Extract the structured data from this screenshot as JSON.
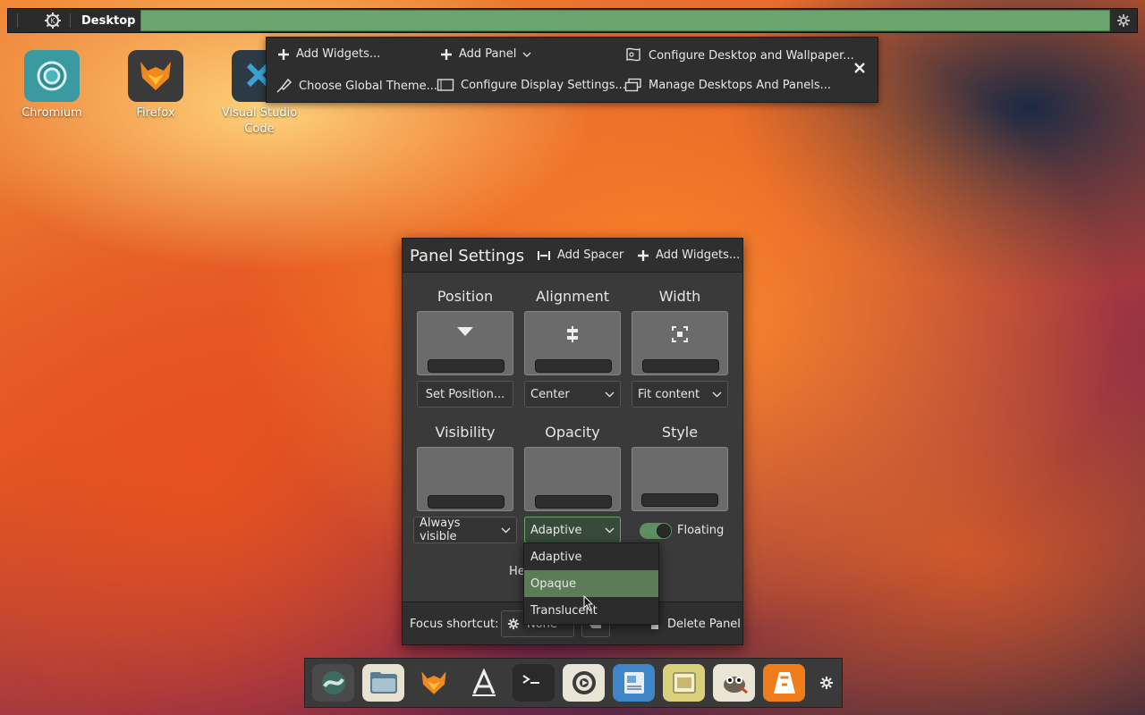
{
  "topbar": {
    "title": "Desktop",
    "accent": "#6aa56e"
  },
  "edit_toolbar": {
    "add_widgets": "Add Widgets...",
    "add_panel": "Add Panel",
    "configure_desktop": "Configure Desktop and Wallpaper...",
    "choose_global_theme": "Choose Global Theme...",
    "configure_display": "Configure Display Settings...",
    "manage_desktops": "Manage Desktops And Panels..."
  },
  "desktop_icons": [
    {
      "label": "Chromium"
    },
    {
      "label": "Firefox"
    },
    {
      "label": "Visual Studio Code"
    }
  ],
  "panel_settings": {
    "title": "Panel Settings",
    "add_spacer": "Add Spacer",
    "add_widgets": "Add Widgets...",
    "position": {
      "label": "Position",
      "value": "Set Position..."
    },
    "alignment": {
      "label": "Alignment",
      "value": "Center"
    },
    "width": {
      "label": "Width",
      "value": "Fit content"
    },
    "visibility": {
      "label": "Visibility",
      "value": "Always visible"
    },
    "opacity": {
      "label": "Opacity",
      "value": "Adaptive"
    },
    "style": {
      "label": "Style",
      "toggle_label": "Floating",
      "floating": true
    },
    "height_partial": "He",
    "focus_shortcut_label": "Focus shortcut:",
    "focus_shortcut_value": "None",
    "delete_panel": "Delete Panel"
  },
  "opacity_dropdown": {
    "options": [
      "Adaptive",
      "Opaque",
      "Translucent"
    ],
    "highlighted": "Opaque"
  },
  "dock": {
    "apps": [
      "Discover",
      "Dolphin",
      "Firefox",
      "Fonts",
      "Konsole",
      "System Settings",
      "Document Viewer",
      "Image Viewer",
      "GIMP",
      "VLC"
    ]
  }
}
